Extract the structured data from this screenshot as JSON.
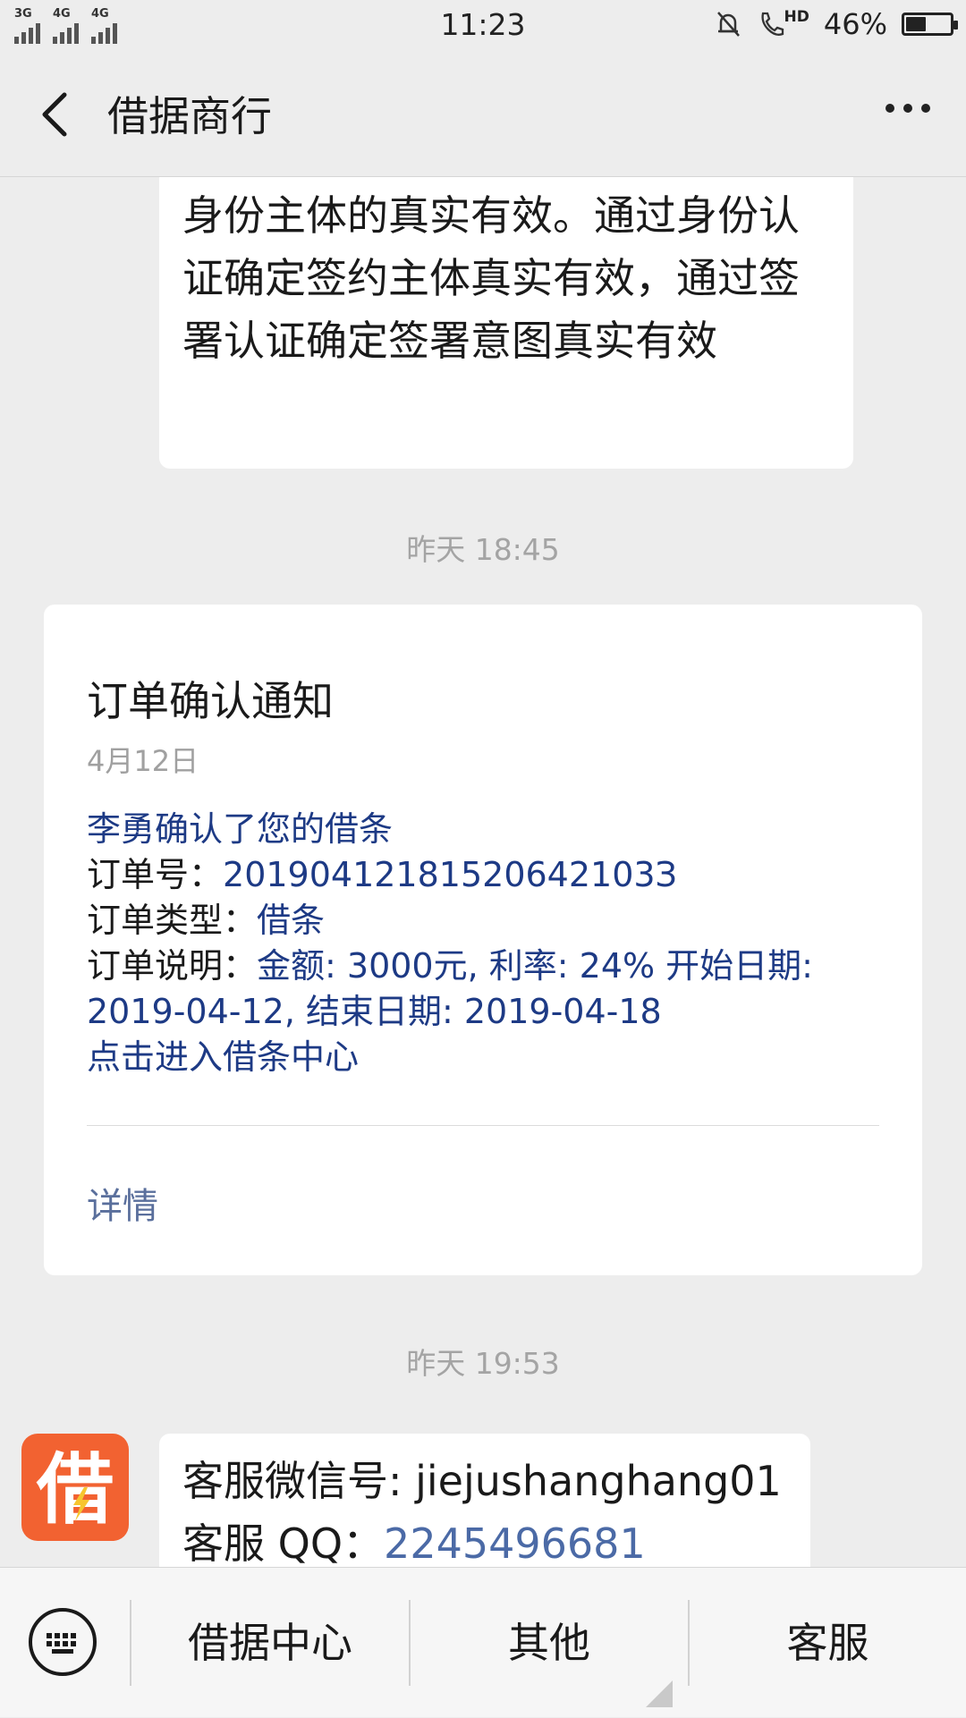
{
  "status_bar": {
    "network_1": "3G",
    "network_2": "4G",
    "network_3": "4G",
    "time": "11:23",
    "hd_label": "HD",
    "battery_text": "46%",
    "battery_level": 0.46
  },
  "header": {
    "title": "借据商行"
  },
  "messages": {
    "msg1_text": "身份主体的真实有效。通过身份认证确定签约主体真实有效，通过签署认证确定签署意图真实有效",
    "time1": "昨天 18:45",
    "card": {
      "title": "订单确认通知",
      "date": "4月12日",
      "line1": "李勇确认了您的借条",
      "order_no_label": "订单号：",
      "order_no": "20190412181520642103З",
      "order_type_label": "订单类型：",
      "order_type": "借条",
      "order_desc_label": "订单说明：",
      "order_desc": "金额: 3000元, 利率: 24% 开始日期: 2019-04-12, 结束日期: 2019-04-18",
      "enter_link": "点击进入借条中心",
      "detail_label": "详情"
    },
    "time2": "昨天 19:53",
    "avatar_char": "借",
    "msg3_line1": "客服微信号: jiejushanghang01",
    "msg3_qq_label": "客服 QQ：",
    "msg3_qq": "2245496681"
  },
  "bottom_menu": {
    "item1": "借据中心",
    "item2": "其他",
    "item3": "客服"
  },
  "colors": {
    "background": "#ededed",
    "card_text": "#1d3a85",
    "avatar": "#f26231"
  }
}
